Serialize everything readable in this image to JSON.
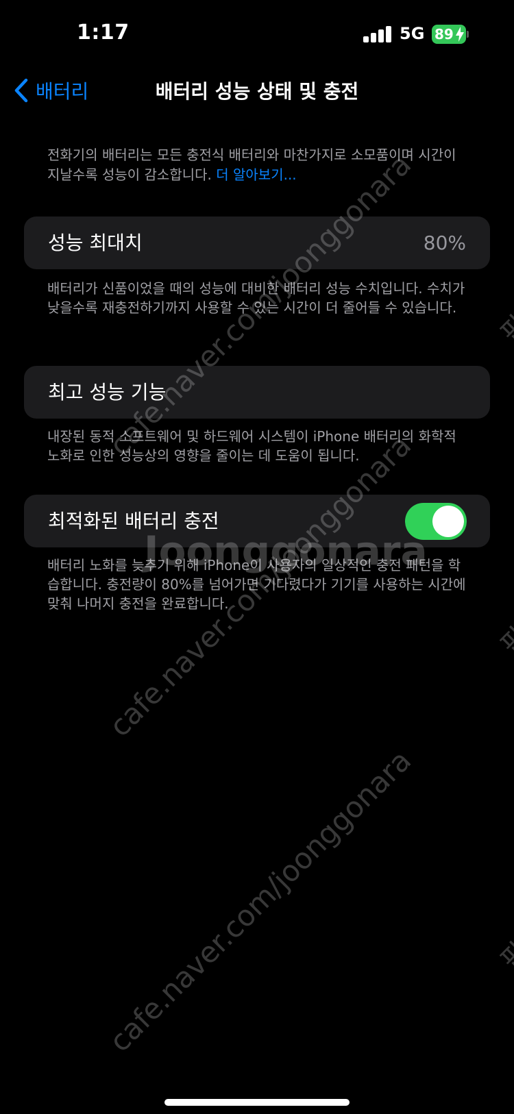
{
  "status_bar": {
    "time": "1:17",
    "network": "5G",
    "battery_level": "89",
    "icons": [
      "signal-icon",
      "battery-icon",
      "charging-bolt-icon"
    ]
  },
  "nav": {
    "back_label": "배터리",
    "title": "배터리 성능 상태 및 충전",
    "back_icon": "chevron-left-icon"
  },
  "intro": {
    "text": "전화기의 배터리는 모든 충전식 배터리와 마찬가지로 소모품이며 시간이 지날수록 성능이 감소합니다. ",
    "link": "더 알아보기..."
  },
  "max_capacity": {
    "label": "성능 최대치",
    "value": "80%",
    "footnote": "배터리가 신품이었을 때의 성능에 대비한 배터리 성능 수치입니다. 수치가 낮을수록 재충전하기까지 사용할 수 있는 시간이 더 줄어들 수 있습니다."
  },
  "peak_performance": {
    "label": "최고 성능 기능",
    "footnote": "내장된 동적 소프트웨어 및 하드웨어 시스템이 iPhone 배터리의 화학적 노화로 인한 성능상의 영향을 줄이는 데 도움이 됩니다."
  },
  "optimized_charging": {
    "label": "최적화된 배터리 충전",
    "enabled": true,
    "footnote": "배터리 노화를 늦추기 위해 iPhone이 사용자의 일상적인 충전 패턴을 학습합니다. 충전량이 80%를 넘어가면 기다렸다가 기기를 사용하는 시간에 맞춰 나머지 충전을 완료합니다."
  },
  "watermarks": {
    "url": "cafe.naver.com/joonggonara",
    "brand": "Joonggonara",
    "side": "판"
  },
  "colors": {
    "accent": "#0a84ff",
    "toggle_on": "#30d158",
    "battery": "#34c759",
    "card": "#1c1c1e"
  }
}
